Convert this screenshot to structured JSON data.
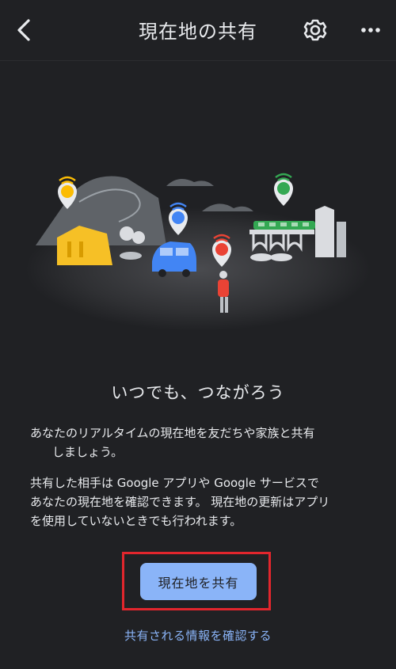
{
  "header": {
    "title": "現在地の共有"
  },
  "content": {
    "headline": "いつでも、つながろう",
    "description_1_lines": [
      "あなたのリアルタイムの現在地を友だちや家族と共有",
      "しましょう。"
    ],
    "description_2_lines": [
      "共有した相手は Google アプリや Google サービスで",
      "あなたの現在地を確認できます。 現在地の更新はアプリ",
      "を使用していないときでも行われます。"
    ]
  },
  "actions": {
    "share_button_label": "現在地を共有",
    "info_link_label": "共有される情報を確認する"
  },
  "colors": {
    "background": "#202124",
    "accent": "#8ab4f8",
    "highlight_border": "#e2262d",
    "pin_yellow": "#fbbc04",
    "pin_blue": "#4285f4",
    "pin_red": "#ea4335",
    "pin_green": "#34a853"
  },
  "icons": {
    "back": "chevron-left-icon",
    "settings": "gear-icon",
    "more": "more-horizontal-icon"
  }
}
